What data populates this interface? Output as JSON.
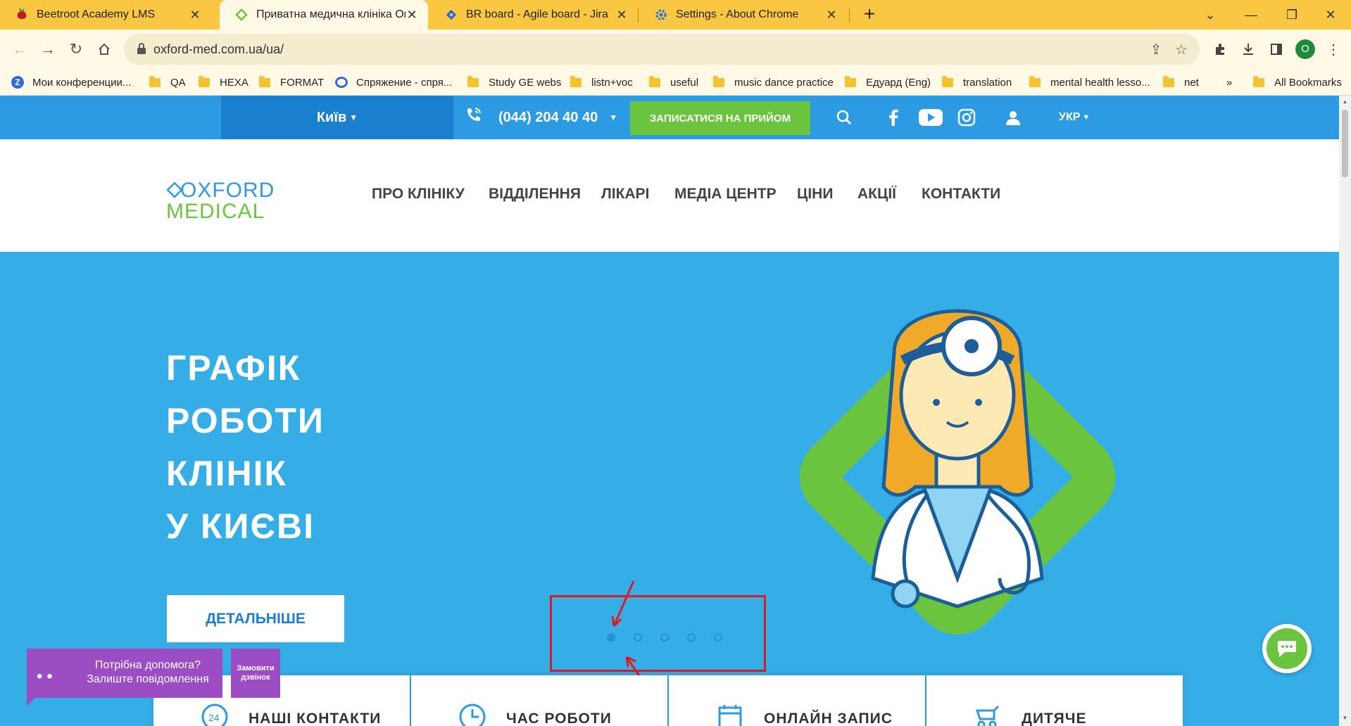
{
  "browser": {
    "tabs": [
      {
        "title": "Beetroot Academy LMS",
        "icon": "beetroot-icon",
        "active": false
      },
      {
        "title": "Приватна медична клініка Оксфорд",
        "icon": "oxford-favicon",
        "active": true
      },
      {
        "title": "BR board - Agile board - Jira",
        "icon": "jira-icon",
        "active": false
      },
      {
        "title": "Settings - About Chrome",
        "icon": "gear-icon",
        "active": false
      }
    ],
    "new_tab": "+",
    "url": "oxford-med.com.ua/ua/",
    "profile_initial": "O",
    "bookmarks": [
      {
        "label": "Мои конференции...",
        "icon": "zoom-icon"
      },
      {
        "label": "QA",
        "icon": "folder-icon"
      },
      {
        "label": "HEXA",
        "icon": "folder-icon"
      },
      {
        "label": "FORMAT",
        "icon": "folder-icon"
      },
      {
        "label": "Спряжение - спря...",
        "icon": "chat-bubble-icon"
      },
      {
        "label": "Study GE webs",
        "icon": "folder-icon"
      },
      {
        "label": "listn+voc",
        "icon": "folder-icon"
      },
      {
        "label": "useful",
        "icon": "folder-icon"
      },
      {
        "label": "music dance practice",
        "icon": "folder-icon"
      },
      {
        "label": "Едуард (Eng)",
        "icon": "folder-icon"
      },
      {
        "label": "translation",
        "icon": "folder-icon"
      },
      {
        "label": "mental health lesso...",
        "icon": "folder-icon"
      },
      {
        "label": "net",
        "icon": "folder-icon"
      }
    ],
    "bookmarks_overflow": "»",
    "all_bookmarks": "All Bookmarks"
  },
  "site": {
    "topbar": {
      "city": "Київ",
      "phone": "(044) 204 40 40",
      "book_button": "ЗАПИСАТИСЯ НА ПРИЙОМ",
      "lang": "УКР"
    },
    "logo": {
      "line1": "OXFORD",
      "line2": "MEDICAL"
    },
    "menu": [
      "ПРО КЛІНІКУ",
      "ВІДДІЛЕННЯ",
      "ЛІКАРІ",
      "МЕДІА ЦЕНТР",
      "ЦІНИ",
      "АКЦІЇ",
      "КОНТАКТИ"
    ],
    "hero": {
      "title_lines": [
        "ГРАФІК",
        "РОБОТИ",
        "КЛІНІК",
        "У КИЄВІ"
      ],
      "button": "ДЕТАЛЬНІШЕ",
      "slides_total": 5,
      "active_slide": 1
    },
    "cards": [
      {
        "label": "НАШІ КОНТАКТИ",
        "icon": "24h-phone-icon"
      },
      {
        "label": "ЧАС РОБОТИ",
        "icon": "clock-icon"
      },
      {
        "label": "ОНЛАЙН ЗАПИС",
        "icon": "calendar-icon"
      },
      {
        "label": "ДИТЯЧЕ ВІДДІЛЕННЯ",
        "icon": "stroller-icon"
      }
    ],
    "help_widget": {
      "line1": "Потрібна допомога?",
      "line2": "Залиште повідомлення"
    },
    "callback": {
      "line1": "Замовити",
      "line2": "дзвінок"
    }
  },
  "colors": {
    "tabstrip": "#f9c742",
    "site_blue": "#2c9be3",
    "hero_blue": "#35aee8",
    "green": "#6ac43d",
    "purple": "#9c4dc4",
    "annotation_red": "#e01a22"
  }
}
